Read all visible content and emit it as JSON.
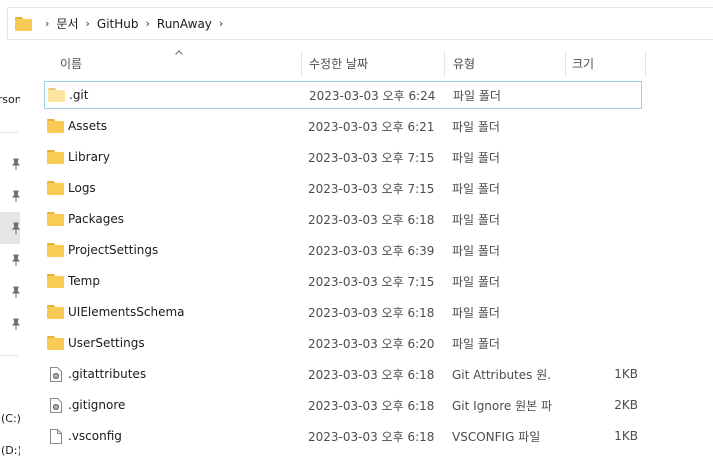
{
  "address": {
    "crumbs": [
      "문서",
      "GitHub",
      "RunAway"
    ],
    "separator": "›"
  },
  "nav": {
    "labels": [
      "ersona",
      "(C:)",
      "(D:)"
    ]
  },
  "header": {
    "name": "이름",
    "date": "수정한 날짜",
    "type": "유형",
    "size": "크기"
  },
  "files": [
    {
      "name": ".git",
      "date": "2023-03-03 오후 6:24",
      "type": "파일 폴더",
      "size": "",
      "icon": "folder-light-icon"
    },
    {
      "name": "Assets",
      "date": "2023-03-03 오후 6:21",
      "type": "파일 폴더",
      "size": "",
      "icon": "folder-icon"
    },
    {
      "name": "Library",
      "date": "2023-03-03 오후 7:15",
      "type": "파일 폴더",
      "size": "",
      "icon": "folder-icon"
    },
    {
      "name": "Logs",
      "date": "2023-03-03 오후 7:15",
      "type": "파일 폴더",
      "size": "",
      "icon": "folder-icon"
    },
    {
      "name": "Packages",
      "date": "2023-03-03 오후 6:18",
      "type": "파일 폴더",
      "size": "",
      "icon": "folder-icon"
    },
    {
      "name": "ProjectSettings",
      "date": "2023-03-03 오후 6:39",
      "type": "파일 폴더",
      "size": "",
      "icon": "folder-icon"
    },
    {
      "name": "Temp",
      "date": "2023-03-03 오후 7:15",
      "type": "파일 폴더",
      "size": "",
      "icon": "folder-icon"
    },
    {
      "name": "UIElementsSchema",
      "date": "2023-03-03 오후 6:18",
      "type": "파일 폴더",
      "size": "",
      "icon": "folder-icon"
    },
    {
      "name": "UserSettings",
      "date": "2023-03-03 오후 6:20",
      "type": "파일 폴더",
      "size": "",
      "icon": "folder-icon"
    },
    {
      "name": ".gitattributes",
      "date": "2023-03-03 오후 6:18",
      "type": "Git Attributes 원...",
      "size": "1KB",
      "icon": "config-file-icon"
    },
    {
      "name": ".gitignore",
      "date": "2023-03-03 오후 6:18",
      "type": "Git Ignore 원본 파...",
      "size": "2KB",
      "icon": "config-file-icon"
    },
    {
      "name": ".vsconfig",
      "date": "2023-03-03 오후 6:18",
      "type": "VSCONFIG 파일",
      "size": "1KB",
      "icon": "file-icon"
    }
  ]
}
